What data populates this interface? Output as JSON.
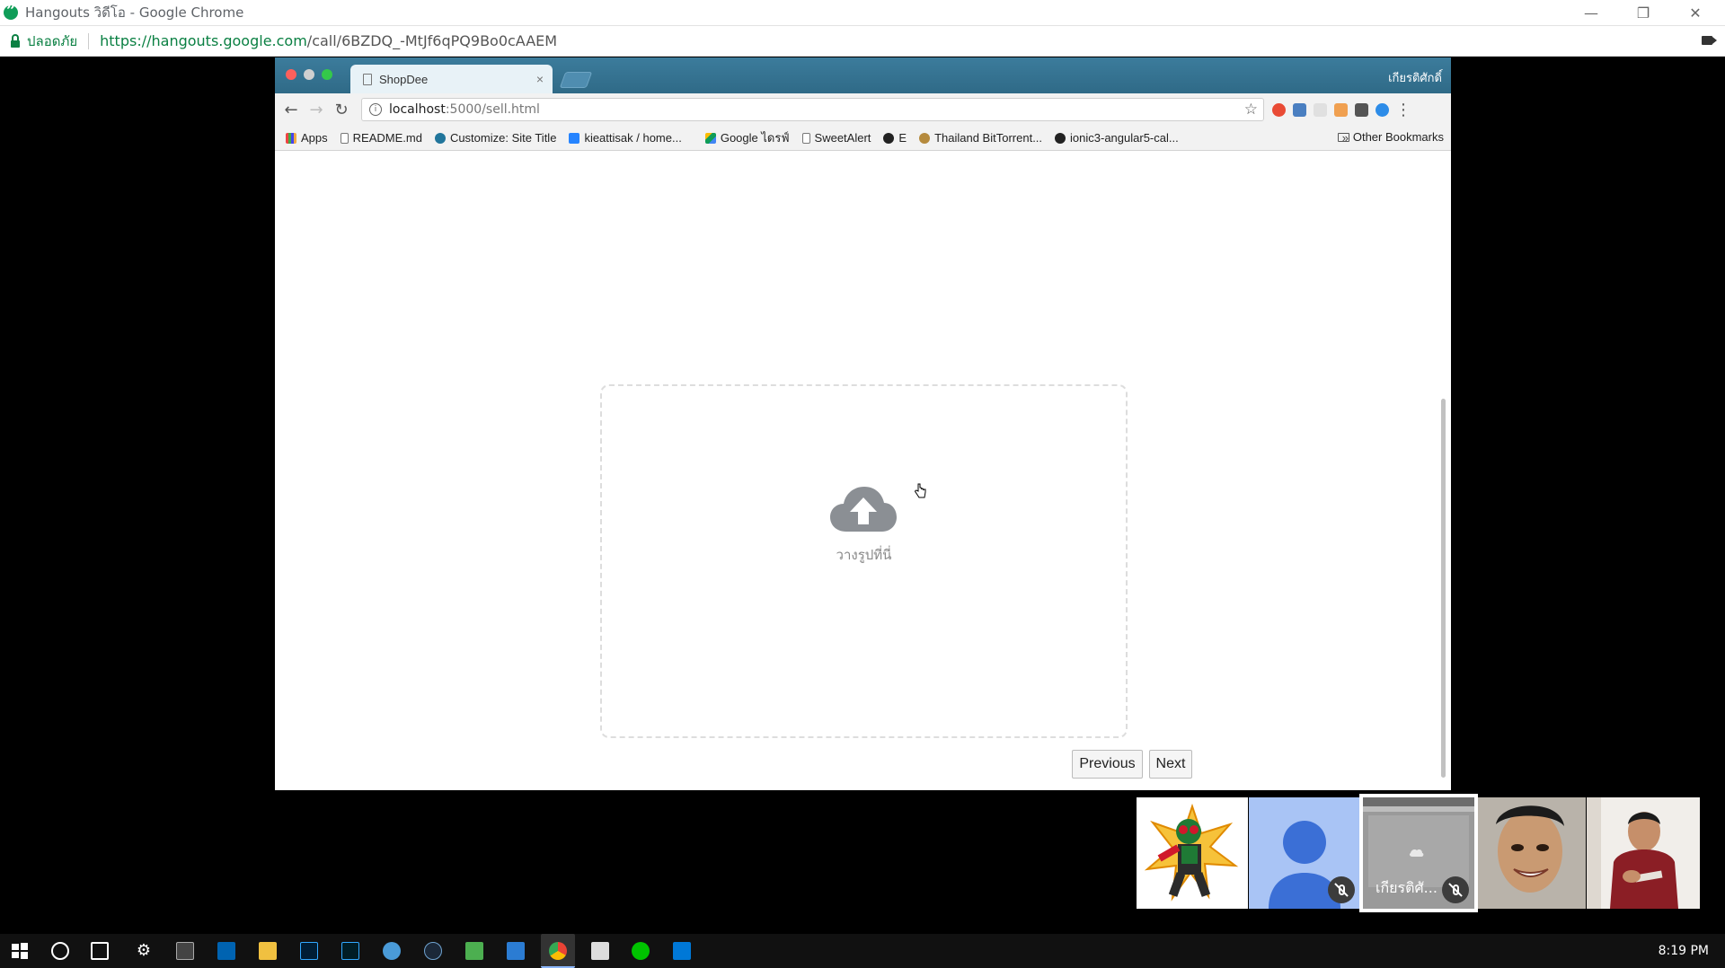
{
  "outer_window": {
    "title": "Hangouts วิดีโอ - Google Chrome",
    "secure_label": "ปลอดภัย",
    "url_host": "https://hangouts.google.com",
    "url_path": "/call/6BZDQ_-MtJf6qPQ9Bo0cAAEM",
    "minimize": "—",
    "restore": "❐",
    "close": "✕"
  },
  "shared_browser": {
    "tab_title": "ShopDee",
    "tab_close": "×",
    "profile_name": "เกียรติศักดิ์",
    "back": "←",
    "forward": "→",
    "reload": "↻",
    "url_host": "localhost",
    "url_path": ":5000/sell.html",
    "star": "☆",
    "menu": "⋮",
    "bookmarks": [
      {
        "label": "Apps",
        "icon": "apps-icon"
      },
      {
        "label": "README.md",
        "icon": "doc-icon"
      },
      {
        "label": "Customize: Site Title",
        "icon": "wordpress-icon"
      },
      {
        "label": "kieattisak / home...",
        "icon": "bitbucket-icon"
      },
      {
        "label": "Google ไดรฟ์",
        "icon": "google-drive-icon"
      },
      {
        "label": "SweetAlert",
        "icon": "doc-icon"
      },
      {
        "label": "E",
        "icon": "github-icon"
      },
      {
        "label": "Thailand BitTorrent...",
        "icon": "torrent-icon"
      },
      {
        "label": "ionic3-angular5-cal...",
        "icon": "github-icon"
      }
    ],
    "bookmarks_more": "»",
    "other_bookmarks": "Other Bookmarks"
  },
  "page": {
    "dropzone_label": "วางรูปที่นี่",
    "previous_label": "Previous",
    "next_label": "Next"
  },
  "participants": {
    "self_label": "เกียรติศั..."
  },
  "taskbar": {
    "clock": "8:19 PM"
  }
}
